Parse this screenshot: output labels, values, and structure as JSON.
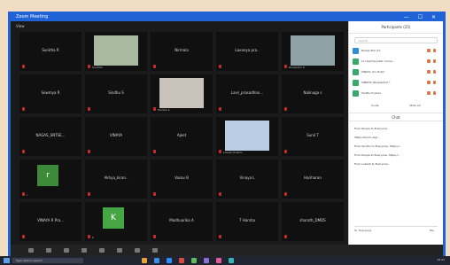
{
  "window": {
    "title": "Zoom Meeting",
    "controls": "— ☐ ✕"
  },
  "gallery": {
    "view_label": "View",
    "tiles": [
      {
        "name": "Sunitha R",
        "sub": ""
      },
      {
        "name": "",
        "sub": "Sunitha"
      },
      {
        "name": "Nirmala",
        "sub": ""
      },
      {
        "name": "Lavanya pra..",
        "sub": ""
      },
      {
        "name": "",
        "sub": "Roopashri K"
      },
      {
        "name": "Sowmya R",
        "sub": ""
      },
      {
        "name": "Sindhu S",
        "sub": ""
      },
      {
        "name": "",
        "sub": "Harsha S"
      },
      {
        "name": "Lavs_prasadhan...",
        "sub": ""
      },
      {
        "name": "Nalinaga s",
        "sub": ""
      },
      {
        "name": "NAGAS_SNTSE...",
        "sub": ""
      },
      {
        "name": "VINAYA",
        "sub": ""
      },
      {
        "name": "Ajeet",
        "sub": ""
      },
      {
        "name": "",
        "sub": "Lokesh Prabhu"
      },
      {
        "name": "Sunil T",
        "sub": ""
      },
      {
        "name": "",
        "sub": "r"
      },
      {
        "name": "Akhya_kiran..",
        "sub": ""
      },
      {
        "name": "Vasav B",
        "sub": ""
      },
      {
        "name": "Vinaya L",
        "sub": ""
      },
      {
        "name": "Hariharan",
        "sub": ""
      },
      {
        "name": "VINAYA R Pra...",
        "sub": ""
      },
      {
        "name": "",
        "sub": "K"
      },
      {
        "name": "Madhuarika A",
        "sub": ""
      },
      {
        "name": "T Harsha",
        "sub": ""
      },
      {
        "name": "sharath_DMDS",
        "sub": ""
      }
    ]
  },
  "panel": {
    "header": "Participants (25)",
    "search_placeholder": "Search",
    "participants": [
      {
        "name": "Roopa Shri (H...",
        "color": "#2d8fd5"
      },
      {
        "name": "Lo rav(me) Joker conne...",
        "color": "#3aa86b"
      },
      {
        "name": "VINAYA (Co-Host)",
        "color": "#3aa86b"
      },
      {
        "name": "SINDHU (Roopashri) *",
        "color": "#3aa86b"
      },
      {
        "name": "Sindhu H Joker",
        "color": "#3aa86b"
      }
    ],
    "invite_label": "Invite",
    "mute_all_label": "Mute All",
    "chat_header": "Chat",
    "messages": [
      "From Roopa to Everyone:",
      "https://zoom.us/j/...",
      "From Sindhu to Everyone: https://...",
      "From Roopa to Everyone: https://...",
      "From Lokesh to Everyone:"
    ],
    "chat_to": "To: Everyone",
    "file_label": "File"
  },
  "taskbar": {
    "search_placeholder": "Type here to search",
    "time": "10:41"
  }
}
